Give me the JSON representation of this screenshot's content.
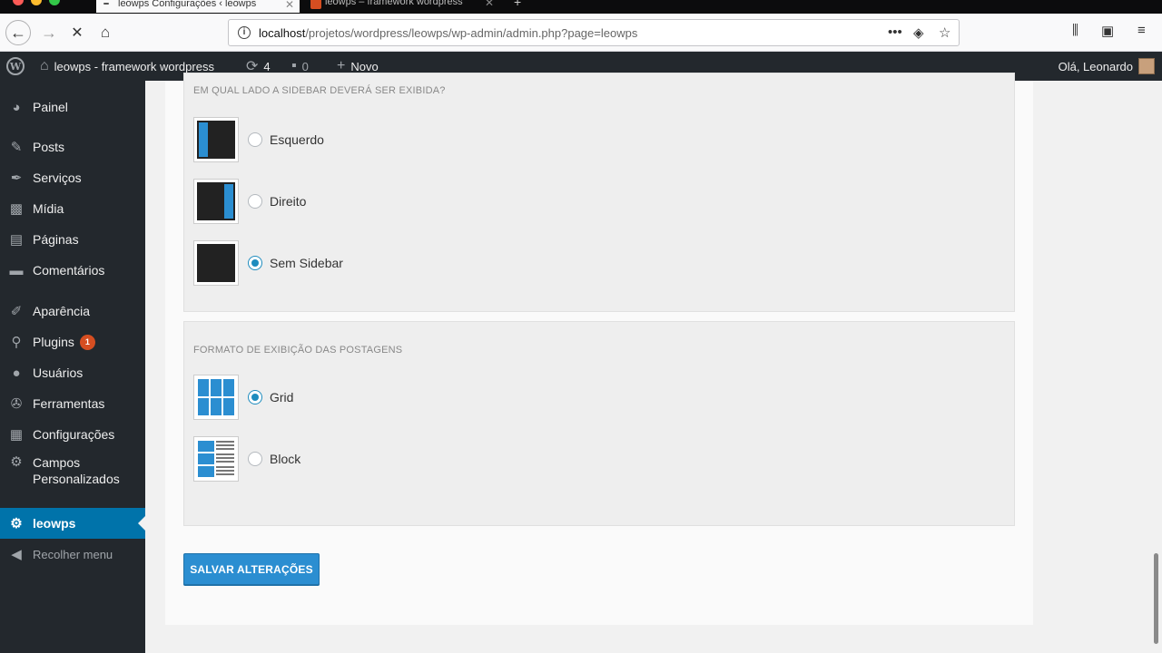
{
  "browser": {
    "tabs": [
      {
        "label": "leowps Configurações ‹ leowps",
        "active": true
      },
      {
        "label": "leowps – framework wordpress",
        "active": false
      }
    ],
    "url_host": "localhost",
    "url_path": "/projetos/wordpress/leowps/wp-admin/admin.php?page=leowps",
    "icons": [
      "back-arrow-icon",
      "forward-arrow-icon",
      "stop-icon",
      "home-icon",
      "info-icon",
      "more-icon",
      "pocket-icon",
      "star-icon",
      "library-icon",
      "sidebar-icon",
      "menu-icon"
    ]
  },
  "adminbar": {
    "site_name": "leowps - framework wordpress",
    "updates_count": "4",
    "comments_count": "0",
    "new_label": "Novo",
    "greeting": "Olá, Leonardo"
  },
  "sidebar": {
    "items": [
      {
        "label": "Painel",
        "icon": "dashboard-icon"
      },
      {
        "label": "Posts",
        "icon": "pin-icon"
      },
      {
        "label": "Serviços",
        "icon": "wrench-icon"
      },
      {
        "label": "Mídia",
        "icon": "media-icon"
      },
      {
        "label": "Páginas",
        "icon": "page-icon"
      },
      {
        "label": "Comentários",
        "icon": "comment-icon"
      },
      {
        "label": "Aparência",
        "icon": "brush-icon"
      },
      {
        "label": "Plugins",
        "icon": "plug-icon",
        "badge": "1"
      },
      {
        "label": "Usuários",
        "icon": "user-icon"
      },
      {
        "label": "Ferramentas",
        "icon": "tool-icon"
      },
      {
        "label": "Configurações",
        "icon": "settings-icon"
      },
      {
        "label": "Campos",
        "label2": "Personalizados",
        "icon": "gear-icon"
      },
      {
        "label": "leowps",
        "icon": "gear-icon",
        "current": true
      },
      {
        "label": "Recolher menu",
        "icon": "collapse-icon"
      }
    ]
  },
  "sidebar_section": {
    "title": "EM QUAL LADO A SIDEBAR DEVERÁ SER EXIBIDA?",
    "options": [
      {
        "label": "Esquerdo",
        "checked": false
      },
      {
        "label": "Direito",
        "checked": false
      },
      {
        "label": "Sem Sidebar",
        "checked": true
      }
    ]
  },
  "posts_section": {
    "title": "FORMATO DE EXIBIÇÃO DAS POSTAGENS",
    "options": [
      {
        "label": "Grid",
        "checked": true
      },
      {
        "label": "Block",
        "checked": false
      }
    ]
  },
  "save_label": "SALVAR ALTERAÇÕES",
  "colors": {
    "accent": "#2b8ed1",
    "admin_bg": "#23282d",
    "current_menu": "#0073aa",
    "badge": "#d54e21"
  }
}
